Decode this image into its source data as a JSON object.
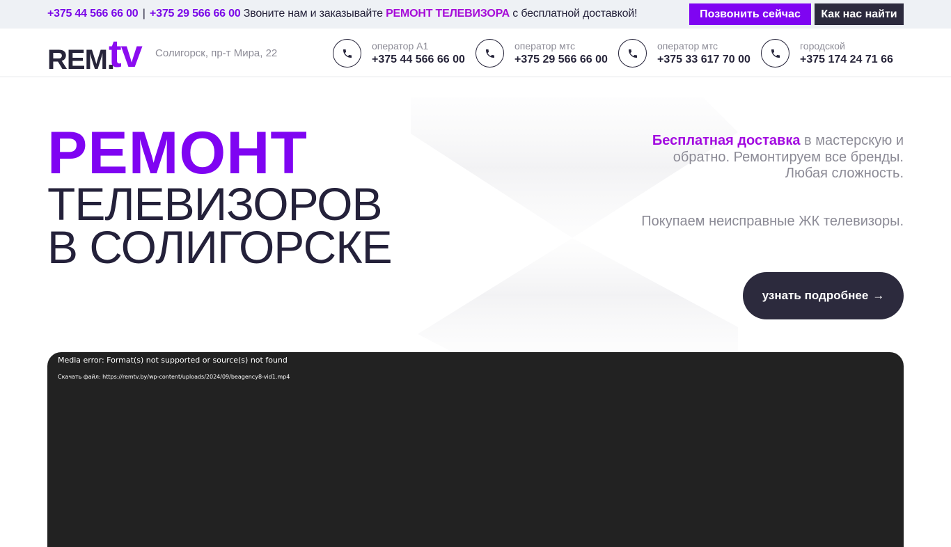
{
  "topbar": {
    "phone1": "+375 44 566 66 00",
    "separator": "|",
    "phone2": "+375 29 566 66 00",
    "text_before": "Звоните нам и заказывайте",
    "highlight": "РЕМОНТ ТЕЛЕВИЗОРА",
    "text_after": "с бесплатной доставкой!",
    "call_button": "Позвонить сейчас",
    "find_button": "Как нас найти"
  },
  "header": {
    "logo_rem": "REM.",
    "logo_tv": "tv",
    "address": "Солигорск, пр-т Мира, 22",
    "contacts": [
      {
        "label": "оператор А1",
        "number": "+375 44 566 66 00",
        "icon": "phone-icon"
      },
      {
        "label": "оператор мтс",
        "number": "+375 29 566 66 00",
        "icon": "phone-icon"
      },
      {
        "label": "оператор мтс",
        "number": "+375 33 617 70 00",
        "icon": "phone-icon"
      },
      {
        "label": "городской",
        "number": "+375 174 24 71 66",
        "icon": "phone-icon"
      }
    ]
  },
  "hero": {
    "title_line1": "РЕМОНТ",
    "title_line2": "ТЕЛЕВИЗОРОВ",
    "title_line3": "В СОЛИГОРСКЕ",
    "delivery_accent": "Бесплатная доставка",
    "delivery_rest": "в мастерскую и обратно.",
    "brands": "Ремонтируем все бренды. Любая сложность.",
    "buy": "Покупаем неисправные ЖК телевизоры.",
    "more_button": "узнать подробнее",
    "more_arrow": "→"
  },
  "video": {
    "error": "Media error: Format(s) not supported or source(s) not found",
    "download": "Скачать файл: https://remtv.by/wp-content/uploads/2024/09/beagency8-vid1.mp4"
  },
  "colors": {
    "accent_purple": "#7f04f2",
    "accent_magenta": "#a60bd8",
    "dark": "#2c2a3d",
    "muted": "#8c8b96",
    "topbar_bg": "#eef1f5",
    "video_bg": "#222222"
  }
}
